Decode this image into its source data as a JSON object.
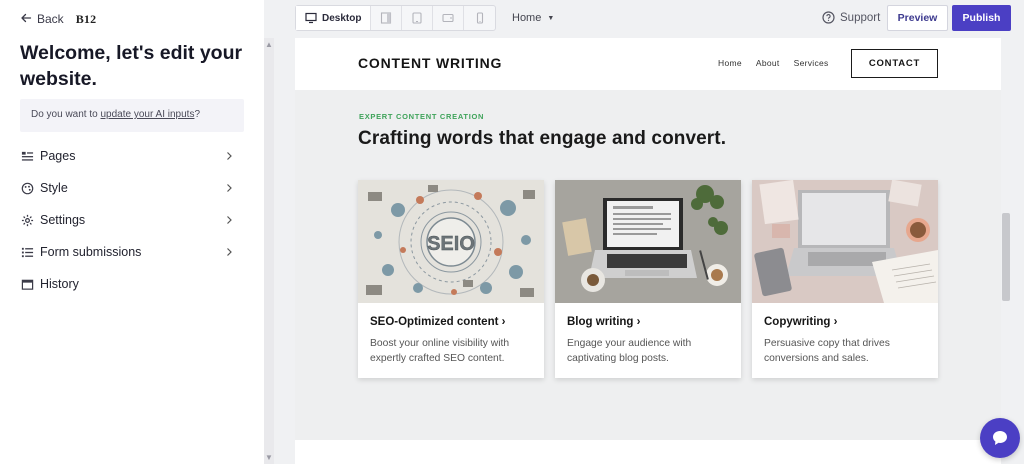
{
  "sidebar": {
    "back_label": "Back",
    "brand": "B12",
    "welcome": "Welcome, let's edit your website.",
    "ai_prompt_prefix": "Do you want to ",
    "ai_prompt_link": "update your AI inputs",
    "ai_prompt_suffix": "?",
    "menu": [
      {
        "label": "Pages",
        "icon": "pages-icon",
        "has_chevron": true
      },
      {
        "label": "Style",
        "icon": "palette-icon",
        "has_chevron": true
      },
      {
        "label": "Settings",
        "icon": "gear-icon",
        "has_chevron": true
      },
      {
        "label": "Form submissions",
        "icon": "list-icon",
        "has_chevron": true
      },
      {
        "label": "History",
        "icon": "calendar-icon",
        "has_chevron": false
      }
    ]
  },
  "toolbar": {
    "devices": [
      {
        "name": "desktop",
        "label": "Desktop",
        "active": true
      },
      {
        "name": "tablet-portrait",
        "label": "",
        "active": false
      },
      {
        "name": "tablet",
        "label": "",
        "active": false
      },
      {
        "name": "tablet-landscape",
        "label": "",
        "active": false
      },
      {
        "name": "mobile",
        "label": "",
        "active": false
      }
    ],
    "page_select": "Home",
    "support_label": "Support",
    "preview_label": "Preview",
    "publish_label": "Publish"
  },
  "site": {
    "logo": "CONTENT WRITING",
    "nav": [
      "Home",
      "About",
      "Services"
    ],
    "contact_label": "CONTACT",
    "eyebrow": "EXPERT CONTENT CREATION",
    "headline": "Crafting words that engage and convert.",
    "cards": [
      {
        "title": "SEO-Optimized content ›",
        "description": "Boost your online visibility with expertly crafted SEO content.",
        "image_text": "SEIO"
      },
      {
        "title": "Blog writing ›",
        "description": "Engage your audience with captivating blog posts."
      },
      {
        "title": "Copywriting ›",
        "description": "Persuasive copy that drives conversions and sales."
      }
    ]
  },
  "colors": {
    "brand_purple": "#4b3fc4",
    "accent_green": "#3fa35a",
    "sidebar_bg": "#ffffff",
    "canvas_bg": "#eeeff0"
  }
}
